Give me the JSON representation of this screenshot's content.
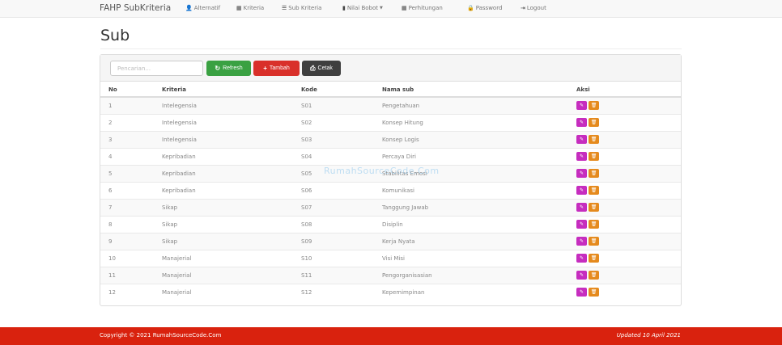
{
  "nav": {
    "brand": "FAHP SubKriteria",
    "items": [
      {
        "icon": "user-icon",
        "glyph": "👤",
        "label": "Alternatif"
      },
      {
        "icon": "grid-icon",
        "glyph": "▦",
        "label": "Kriteria"
      },
      {
        "icon": "list-icon",
        "glyph": "☰",
        "label": "Sub Kriteria"
      },
      {
        "icon": "bar-chart-icon",
        "glyph": "▮",
        "label": "Nilai Bobot"
      },
      {
        "icon": "calculator-icon",
        "glyph": "▦",
        "label": "Perhitungan"
      },
      {
        "icon": "lock-icon",
        "glyph": "🔒",
        "label": "Password"
      },
      {
        "icon": "logout-icon",
        "glyph": "⇥",
        "label": "Logout"
      }
    ]
  },
  "page": {
    "title": "Sub"
  },
  "toolbar": {
    "search_placeholder": "Pencarian...",
    "refresh_label": "Refresh",
    "add_label": "Tambah",
    "print_label": "Cetak"
  },
  "table": {
    "headers": [
      "No",
      "Kriteria",
      "Kode",
      "Nama sub",
      "Aksi"
    ],
    "rows": [
      [
        "1",
        "Intelegensia",
        "S01",
        "Pengetahuan"
      ],
      [
        "2",
        "Intelegensia",
        "S02",
        "Konsep Hitung"
      ],
      [
        "3",
        "Intelegensia",
        "S03",
        "Konsep Logis"
      ],
      [
        "4",
        "Kepribadian",
        "S04",
        "Percaya Diri"
      ],
      [
        "5",
        "Kepribadian",
        "S05",
        "Stabilitas Emosi"
      ],
      [
        "6",
        "Kepribadian",
        "S06",
        "Komunikasi"
      ],
      [
        "7",
        "Sikap",
        "S07",
        "Tanggung Jawab"
      ],
      [
        "8",
        "Sikap",
        "S08",
        "Disiplin"
      ],
      [
        "9",
        "Sikap",
        "S09",
        "Kerja Nyata"
      ],
      [
        "10",
        "Manajerial",
        "S10",
        "Visi Misi"
      ],
      [
        "11",
        "Manajerial",
        "S11",
        "Pengorganisasian"
      ],
      [
        "12",
        "Manajerial",
        "S12",
        "Kepemimpinan"
      ]
    ]
  },
  "watermark": "RumahSourceCode.Com",
  "footer": {
    "copyright": "Copyright © 2021 RumahSourceCode.Com",
    "updated": "Updated 10 April 2021"
  },
  "colors": {
    "refresh": "#3aa142",
    "tambah": "#d9302a",
    "cetak": "#3f3f3f",
    "edit": "#c62dbf",
    "delete": "#e58a1d",
    "footer": "#d9220e"
  }
}
